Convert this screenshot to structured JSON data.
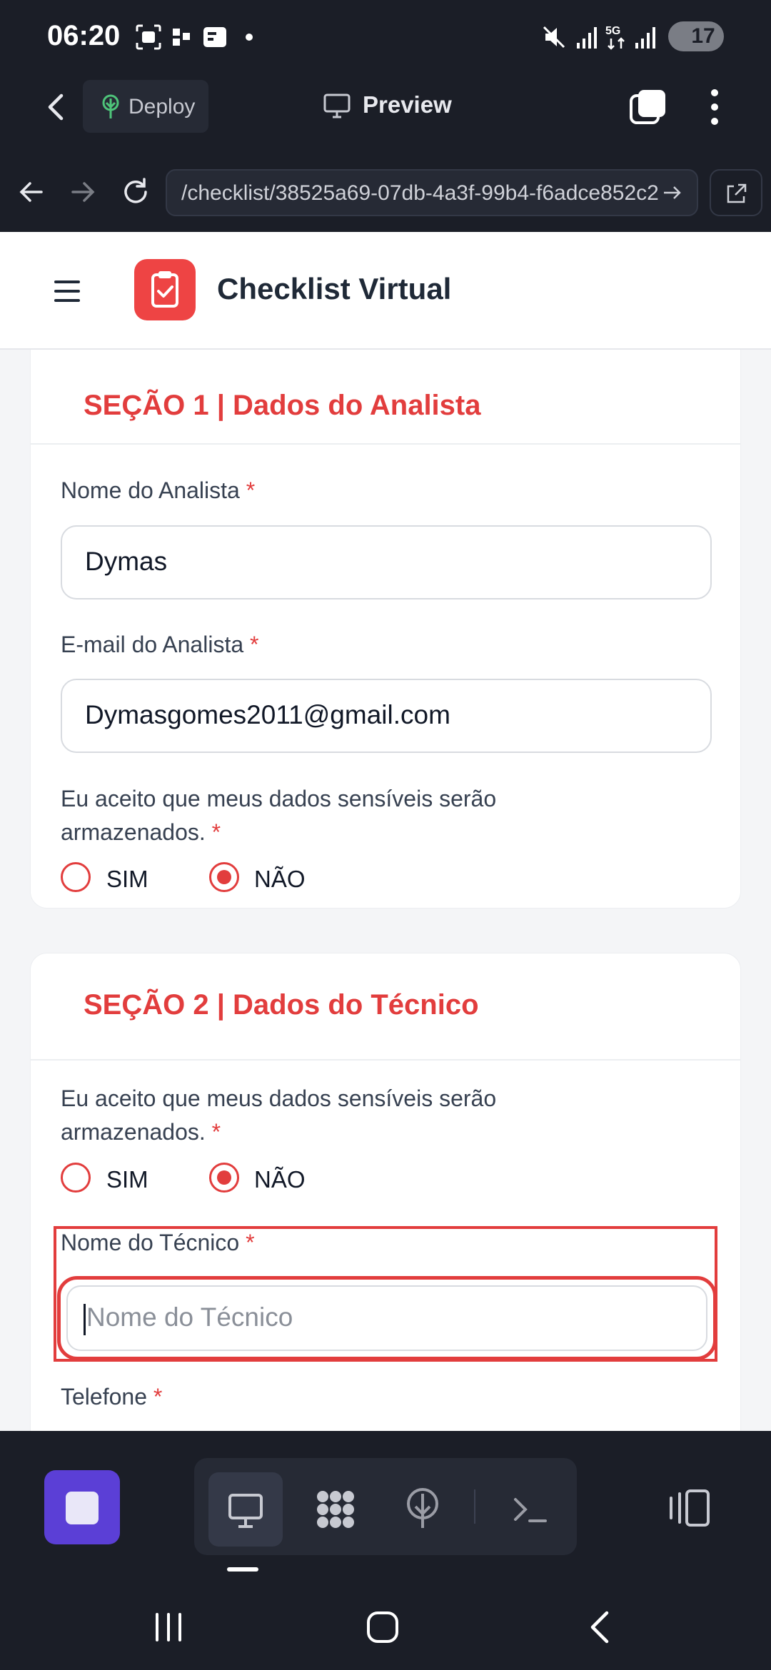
{
  "status_bar": {
    "time": "06:20",
    "battery": "17",
    "icons": [
      "screenshot-icon",
      "cast-icon",
      "wallet-icon",
      "dot-icon",
      "mute-icon",
      "signal-icon",
      "5g-icon",
      "signal-icon",
      "battery-icon"
    ]
  },
  "toolbar": {
    "deploy_label": "Deploy",
    "preview_label": "Preview"
  },
  "url_bar": {
    "url": "/checklist/38525a69-07db-4a3f-99b4-f6adce852c2"
  },
  "app": {
    "title": "Checklist Virtual",
    "accent": "#e23d3d",
    "logo_bg": "#ee4444"
  },
  "section1": {
    "title": "SEÇÃO 1 | Dados do Analista",
    "name_label": "Nome do Analista",
    "name_value": "Dymas",
    "email_label": "E-mail do Analista",
    "email_value": "Dymasgomes2011@gmail.com",
    "consent_line1": "Eu aceito que meus dados sensíveis serão",
    "consent_line2": "armazenados.",
    "option_yes": "SIM",
    "option_no": "NÃO",
    "selected": "NÃO"
  },
  "section2": {
    "title": "SEÇÃO 2 | Dados do Técnico",
    "consent_line1": "Eu aceito que meus dados sensíveis serão",
    "consent_line2": "armazenados.",
    "option_yes": "SIM",
    "option_no": "NÃO",
    "selected": "NÃO",
    "tech_name_label": "Nome do Técnico",
    "tech_name_placeholder": "Nome do Técnico",
    "phone_label": "Telefone"
  },
  "required_mark": "*",
  "dev_toolbar": {
    "items": [
      "stop-icon",
      "monitor-icon",
      "apps-icon",
      "deploy-icon",
      "terminal-icon",
      "side-panel-icon"
    ]
  },
  "nav_bar": {
    "items": [
      "recents-icon",
      "home-icon",
      "back-icon"
    ]
  }
}
